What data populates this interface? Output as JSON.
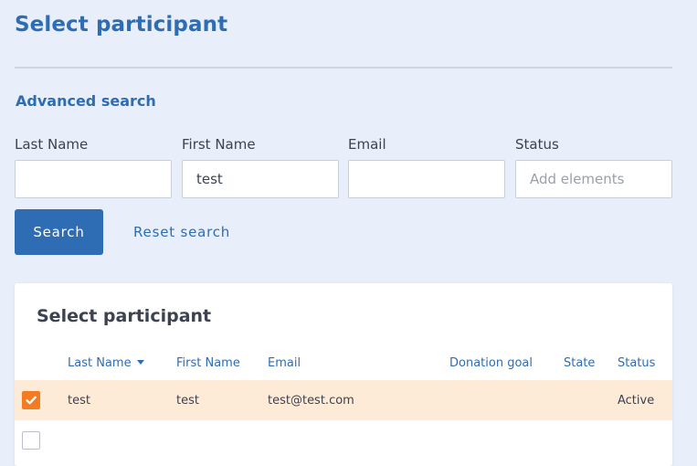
{
  "page": {
    "title": "Select participant"
  },
  "search": {
    "advanced_link": "Advanced search",
    "fields": [
      {
        "label": "Last Name",
        "value": "",
        "placeholder": ""
      },
      {
        "label": "First Name",
        "value": "test",
        "placeholder": ""
      },
      {
        "label": "Email",
        "value": "",
        "placeholder": ""
      },
      {
        "label": "Status",
        "value": "",
        "placeholder": "Add elements"
      }
    ],
    "search_button": "Search",
    "reset_link": "Reset search"
  },
  "results": {
    "title": "Select participant",
    "columns": [
      "Last Name",
      "First Name",
      "Email",
      "Donation goal",
      "State",
      "Status"
    ],
    "sorted_column": "Last Name",
    "rows": [
      {
        "selected": true,
        "last_name": "test",
        "first_name": "test",
        "email": "test@test.com",
        "donation_goal": "",
        "state": "",
        "status": "Active"
      },
      {
        "selected": false
      }
    ]
  },
  "colors": {
    "accent": "#2e6db4",
    "checkbox_checked": "#f37c22",
    "selected_row": "#fdebd8",
    "background": "#e8eefa"
  }
}
